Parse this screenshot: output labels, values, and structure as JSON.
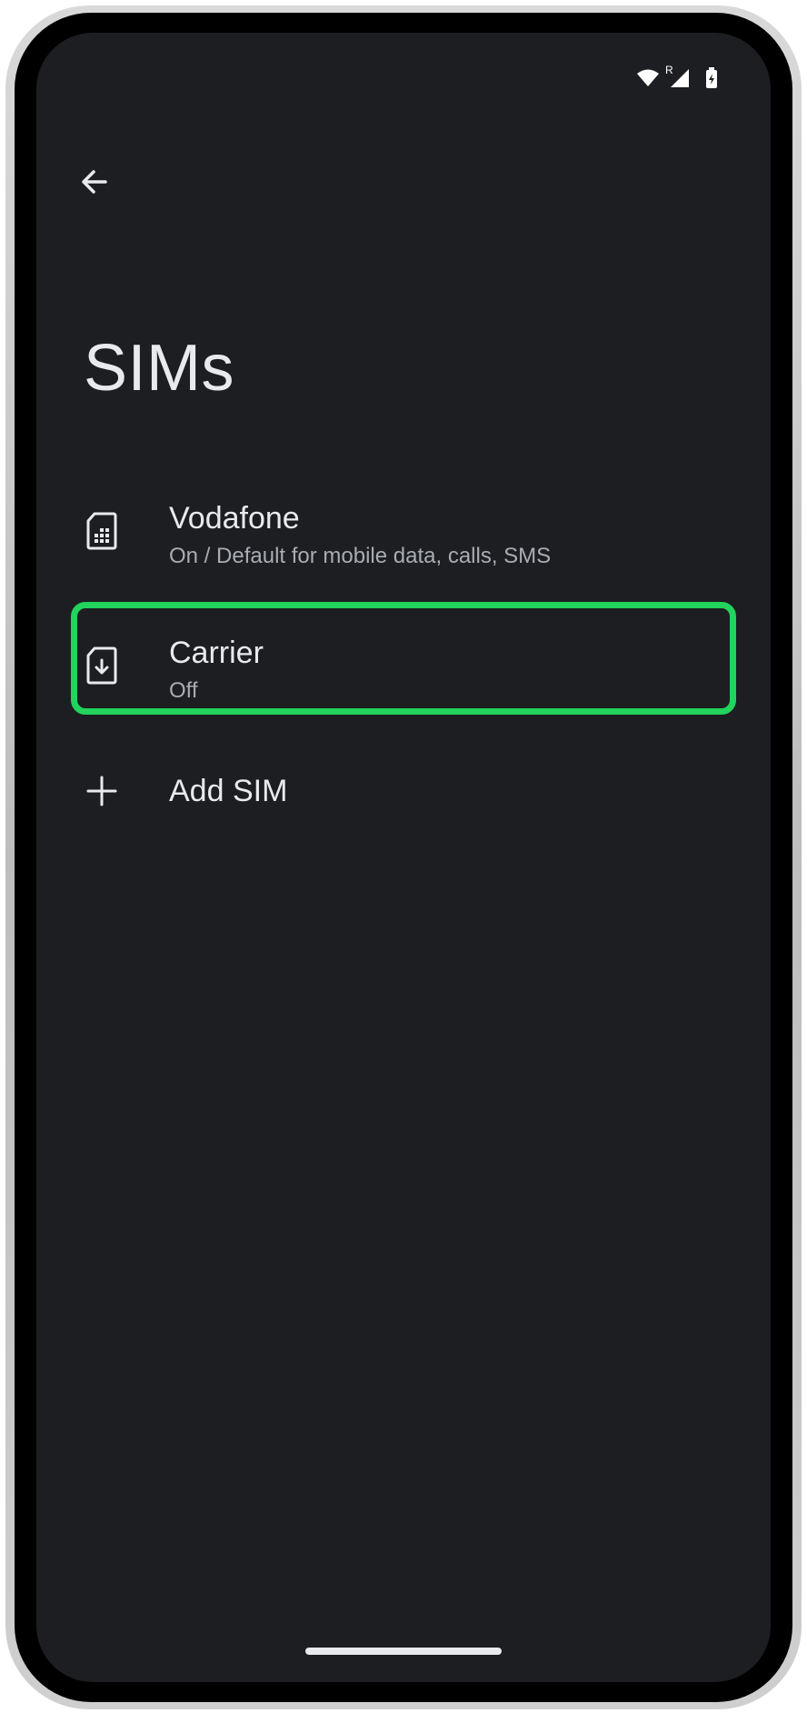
{
  "status_bar": {
    "wifi_icon": "wifi-icon",
    "roaming_indicator": "R",
    "signal_icon": "cell-signal-icon",
    "battery_icon": "battery-icon"
  },
  "header": {
    "back_icon": "arrow-left-icon",
    "title": "SIMs"
  },
  "sim_list": [
    {
      "icon": "sim-card-icon",
      "title": "Vodafone",
      "subtitle": "On / Default for mobile data, calls, SMS"
    },
    {
      "icon": "esim-download-icon",
      "title": "Carrier",
      "subtitle": "Off",
      "highlighted": true
    }
  ],
  "add_sim": {
    "icon": "plus-icon",
    "label": "Add SIM"
  },
  "colors": {
    "background": "#1c1e22",
    "text_primary": "#e8eaed",
    "text_secondary": "#a9acb1",
    "highlight": "#22d35c"
  }
}
